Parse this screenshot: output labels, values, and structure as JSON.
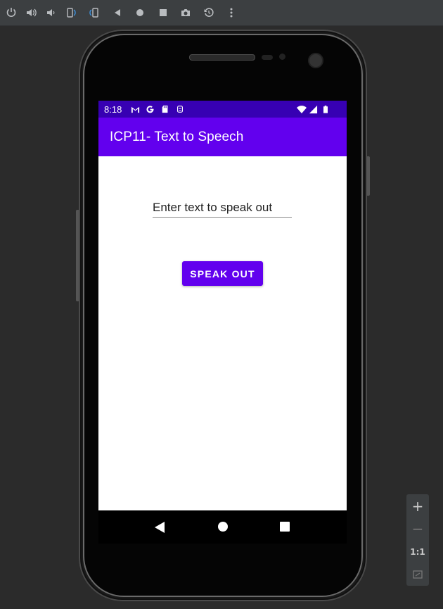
{
  "toolbar": {
    "icons": [
      "power-icon",
      "volume-up-icon",
      "volume-down-icon",
      "rotate-left-icon",
      "rotate-right-icon",
      "back-icon",
      "home-icon",
      "overview-icon",
      "screenshot-icon",
      "snapshot-icon",
      "more-icon"
    ]
  },
  "status_bar": {
    "time": "8:18",
    "icons": [
      "gmail-icon",
      "google-icon",
      "sd-card-icon",
      "notification-icon",
      "wifi-icon",
      "signal-icon",
      "battery-icon"
    ]
  },
  "app_bar": {
    "title": "ICP11- Text to Speech"
  },
  "main": {
    "text_input": {
      "placeholder": "Enter text to speak out",
      "value": ""
    },
    "speak_button": {
      "label": "SPEAK OUT"
    }
  },
  "zoom_panel": {
    "zoom_in": "+",
    "zoom_out": "−",
    "actual_size": "1:1"
  },
  "colors": {
    "status_bar": "#3700b3",
    "app_bar": "#6200ee",
    "button": "#6200ee",
    "toolbar": "#3c3f41"
  }
}
